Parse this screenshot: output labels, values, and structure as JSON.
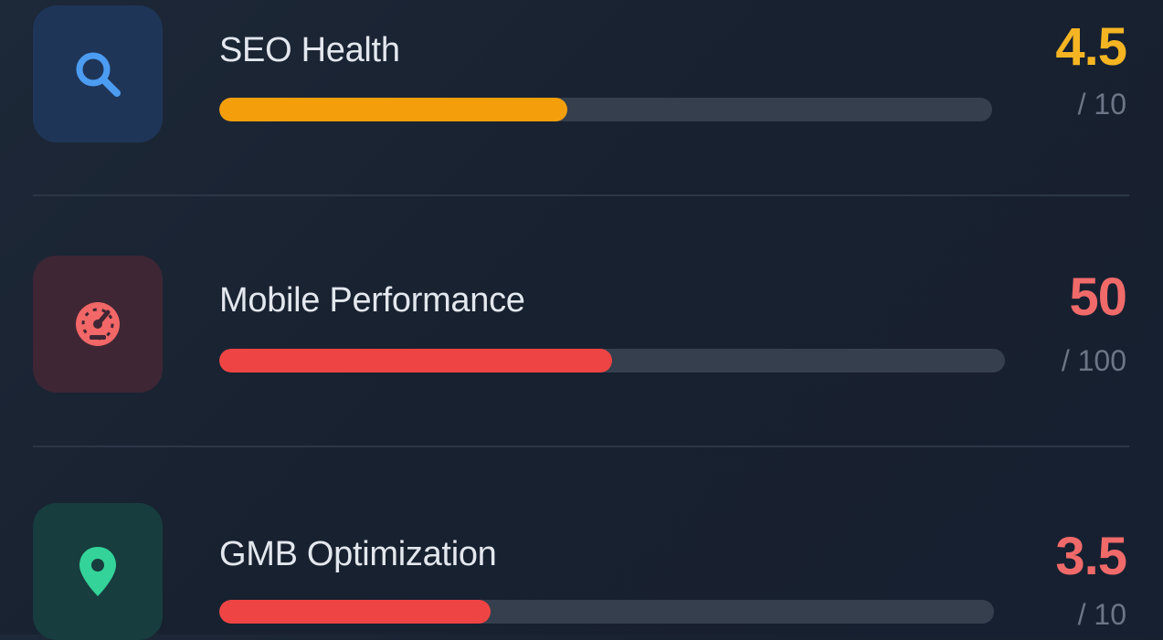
{
  "metrics": [
    {
      "label": "SEO Health",
      "score": "4.5",
      "max_label": "/ 10",
      "fill_fraction": 0.45,
      "icon": "search-icon",
      "color": "#f59e0b",
      "score_color": "#f5b523",
      "tile_color": "#1f3558",
      "icon_color": "#4c9cf2"
    },
    {
      "label": "Mobile Performance",
      "score": "50",
      "max_label": "/ 100",
      "fill_fraction": 0.5,
      "icon": "speedometer-icon",
      "color": "#ef4444",
      "score_color": "#f06a6a",
      "tile_color": "#3f2634",
      "icon_color": "#f26767"
    },
    {
      "label": "GMB Optimization",
      "score": "3.5",
      "max_label": "/ 10",
      "fill_fraction": 0.35,
      "icon": "map-pin-icon",
      "color": "#ef4444",
      "score_color": "#f06a6a",
      "tile_color": "#173d3e",
      "icon_color": "#34d399"
    }
  ]
}
